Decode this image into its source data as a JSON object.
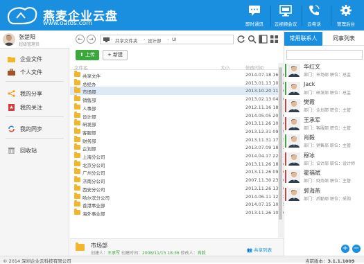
{
  "header": {
    "title": "燕麦企业云盘",
    "url": "www.oatos.com",
    "buttons": [
      {
        "label": "即时通讯",
        "icon": "chat-icon"
      },
      {
        "label": "云视频会议",
        "icon": "video-conference-icon"
      },
      {
        "label": "云电话",
        "icon": "phone-icon"
      },
      {
        "label": "管理后台",
        "icon": "gear-icon"
      }
    ]
  },
  "user": {
    "name": "张楚阳",
    "role": "超级管理员"
  },
  "sidebar": {
    "items": [
      {
        "label": "企业文件",
        "icon": "enterprise-files-icon"
      },
      {
        "label": "个人文件",
        "icon": "personal-files-icon"
      },
      {
        "label": "我的分享",
        "icon": "share-icon"
      },
      {
        "label": "我的关注",
        "icon": "bookmark-icon"
      },
      {
        "label": "我的同步",
        "icon": "sync-icon"
      },
      {
        "label": "回收站",
        "icon": "trash-icon"
      }
    ]
  },
  "breadcrumb": {
    "items": [
      "共享文件夹",
      "设计部",
      "UI"
    ]
  },
  "actions": {
    "upload": "上传",
    "new": "新建"
  },
  "columns": {
    "name": "文件名",
    "size": "大小",
    "time": "修改时间"
  },
  "files": [
    {
      "name": "共享文件",
      "time": "2014.07.18 16:26"
    },
    {
      "name": "总经办",
      "time": "2013.01.13 10:28"
    },
    {
      "name": "市场部",
      "time": "2013.10.20 11:30"
    },
    {
      "name": "销售部",
      "time": "2013.02.13 04:16"
    },
    {
      "name": "人事部",
      "time": "2012.11.16 18:01"
    },
    {
      "name": "设计部",
      "time": "2014.05.05 20:30"
    },
    {
      "name": "研发部",
      "time": "2013.11.26 10:36"
    },
    {
      "name": "客服部",
      "time": "2013.12.31 09:59"
    },
    {
      "name": "财务部",
      "time": "2013.11.31 17:45"
    },
    {
      "name": "企划部",
      "time": "2013.07.09 18:22"
    },
    {
      "name": "上海分公司",
      "time": "2014.04.17 22:41"
    },
    {
      "name": "北京分公司",
      "time": "2013.11.26 18:36"
    },
    {
      "name": "广州分公司",
      "time": "2013.11.26 09:36"
    },
    {
      "name": "济南分公司",
      "time": "2007.11.30 23:36"
    },
    {
      "name": "西安分公司",
      "time": "2013.11.26 13:36"
    },
    {
      "name": "哈尔滨分公司",
      "time": "2014.06.11 12:12"
    },
    {
      "name": "香港事业部",
      "time": "2014.07.15 10:45"
    },
    {
      "name": "海外事业部",
      "time": "2013.11.26 10:36"
    }
  ],
  "info": {
    "name": "市场部",
    "creator_label": "创建人：",
    "creator": "王承军",
    "time_label": "创建时间：",
    "time": "2008/11/15 18:36",
    "modifier_label": "修改人：",
    "modifier": "肖毅",
    "share_link": "共享列表"
  },
  "right_tabs": [
    "常用联系人",
    "同事列表"
  ],
  "contacts": [
    {
      "name": "华红文",
      "dept": "部门：市场部",
      "title": "职位：总监"
    },
    {
      "name": "Jack",
      "dept": "部门：研发部",
      "title": "职位：总监"
    },
    {
      "name": "樊霞",
      "dept": "部门：企划部",
      "title": "职位：主管"
    },
    {
      "name": "王承军",
      "dept": "部门：客服部",
      "title": "职位：主管"
    },
    {
      "name": "肖毅",
      "dept": "部门：销售部",
      "title": "职位：主管"
    },
    {
      "name": "穆冰",
      "dept": "部门：设计部",
      "title": "职位：设计师"
    },
    {
      "name": "霍福斌",
      "dept": "部门：财务部",
      "title": "职位：主管"
    },
    {
      "name": "郭海燕",
      "dept": "部门：后勤部",
      "title": "职位：采购"
    }
  ],
  "footer": {
    "copyright": "© 2014 深圳企业云科技有限公司",
    "version_label": "当前版本：",
    "version": "3.1.1.1009"
  },
  "colors": {
    "brand": "#1a8fe0",
    "upload": "#3aa83a",
    "folder": "#f3b52b"
  }
}
